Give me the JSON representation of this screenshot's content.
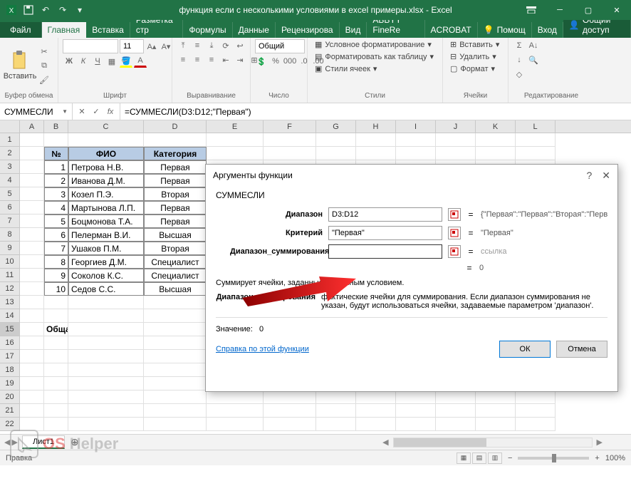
{
  "app": {
    "title": "функция если с несколькими условиями в excel примеры.xlsx - Excel",
    "qat_save": "save",
    "qat_undo": "undo",
    "qat_redo": "redo"
  },
  "tabs": {
    "file": "Файл",
    "home": "Главная",
    "insert": "Вставка",
    "layout": "Разметка стр",
    "formulas": "Формулы",
    "data": "Данные",
    "review": "Рецензирова",
    "view": "Вид",
    "abbyy": "ABBYY FineRe",
    "acrobat": "ACROBAT",
    "help": "Помощ",
    "login": "Вход",
    "share": "Общий доступ"
  },
  "ribbon": {
    "clipboard": {
      "label": "Буфер обмена",
      "paste": "Вставить"
    },
    "font": {
      "label": "Шрифт",
      "name": "",
      "size": "11"
    },
    "alignment": {
      "label": "Выравнивание"
    },
    "number": {
      "label": "Число",
      "format": "Общий"
    },
    "styles": {
      "label": "Стили",
      "cond": "Условное форматирование",
      "table": "Форматировать как таблицу",
      "cell": "Стили ячеек"
    },
    "cells": {
      "label": "Ячейки",
      "insert": "Вставить",
      "delete": "Удалить",
      "format": "Формат"
    },
    "editing": {
      "label": "Редактирование"
    }
  },
  "fxbar": {
    "namebox": "СУММЕСЛИ",
    "formula": "=СУММЕСЛИ(D3:D12;\"Первая\")"
  },
  "columns": [
    "A",
    "B",
    "C",
    "D",
    "E",
    "F",
    "G",
    "H",
    "I",
    "J",
    "K",
    "L"
  ],
  "table": {
    "headers": {
      "num": "№",
      "fio": "ФИО",
      "cat": "Категория"
    },
    "rows": [
      {
        "n": "1",
        "fio": "Петрова Н.В.",
        "cat": "Первая"
      },
      {
        "n": "2",
        "fio": "Иванова Д.М.",
        "cat": "Первая"
      },
      {
        "n": "3",
        "fio": "Козел П.Э.",
        "cat": "Вторая"
      },
      {
        "n": "4",
        "fio": "Мартынова Л.П.",
        "cat": "Первая"
      },
      {
        "n": "5",
        "fio": "Боцмонова Т.А.",
        "cat": "Первая"
      },
      {
        "n": "6",
        "fio": "Пелерман В.И.",
        "cat": "Высшая"
      },
      {
        "n": "7",
        "fio": "Ушаков П.М.",
        "cat": "Вторая"
      },
      {
        "n": "8",
        "fio": "Георгиев Д.М.",
        "cat": "Специалист"
      },
      {
        "n": "9",
        "fio": "Соколов К.С.",
        "cat": "Специалист"
      },
      {
        "n": "10",
        "fio": "Седов С.С.",
        "cat": "Высшая"
      }
    ],
    "summary": "Общая зарплата учителей пер"
  },
  "dialog": {
    "title": "Аргументы функции",
    "fn": "СУММЕСЛИ",
    "args": {
      "range_label": "Диапазон",
      "range_val": "D3:D12",
      "range_res": "{\"Первая\":\"Первая\":\"Вторая\":\"Перва",
      "crit_label": "Критерий",
      "crit_val": "\"Первая\"",
      "crit_res": "\"Первая\"",
      "sum_label": "Диапазон_суммирования",
      "sum_val": "",
      "sum_res": "ссылка",
      "final_eq": "0"
    },
    "eq": "=",
    "desc1": "Суммирует ячейки, заданные указанным условием.",
    "desc2_label": "Диапазон_суммирования",
    "desc2_text": "фактические ячейки для суммирования. Если диапазон суммирования не указан, будут использоваться ячейки, задаваемые параметром 'диапазон'.",
    "value_label": "Значение:",
    "value": "0",
    "help": "Справка по этой функции",
    "ok": "ОК",
    "cancel": "Отмена"
  },
  "sheet": {
    "name": "Лист1"
  },
  "status": {
    "ready": "Правка",
    "zoom": "100%"
  },
  "watermark": {
    "os": "OS",
    "helper": "Helper"
  }
}
